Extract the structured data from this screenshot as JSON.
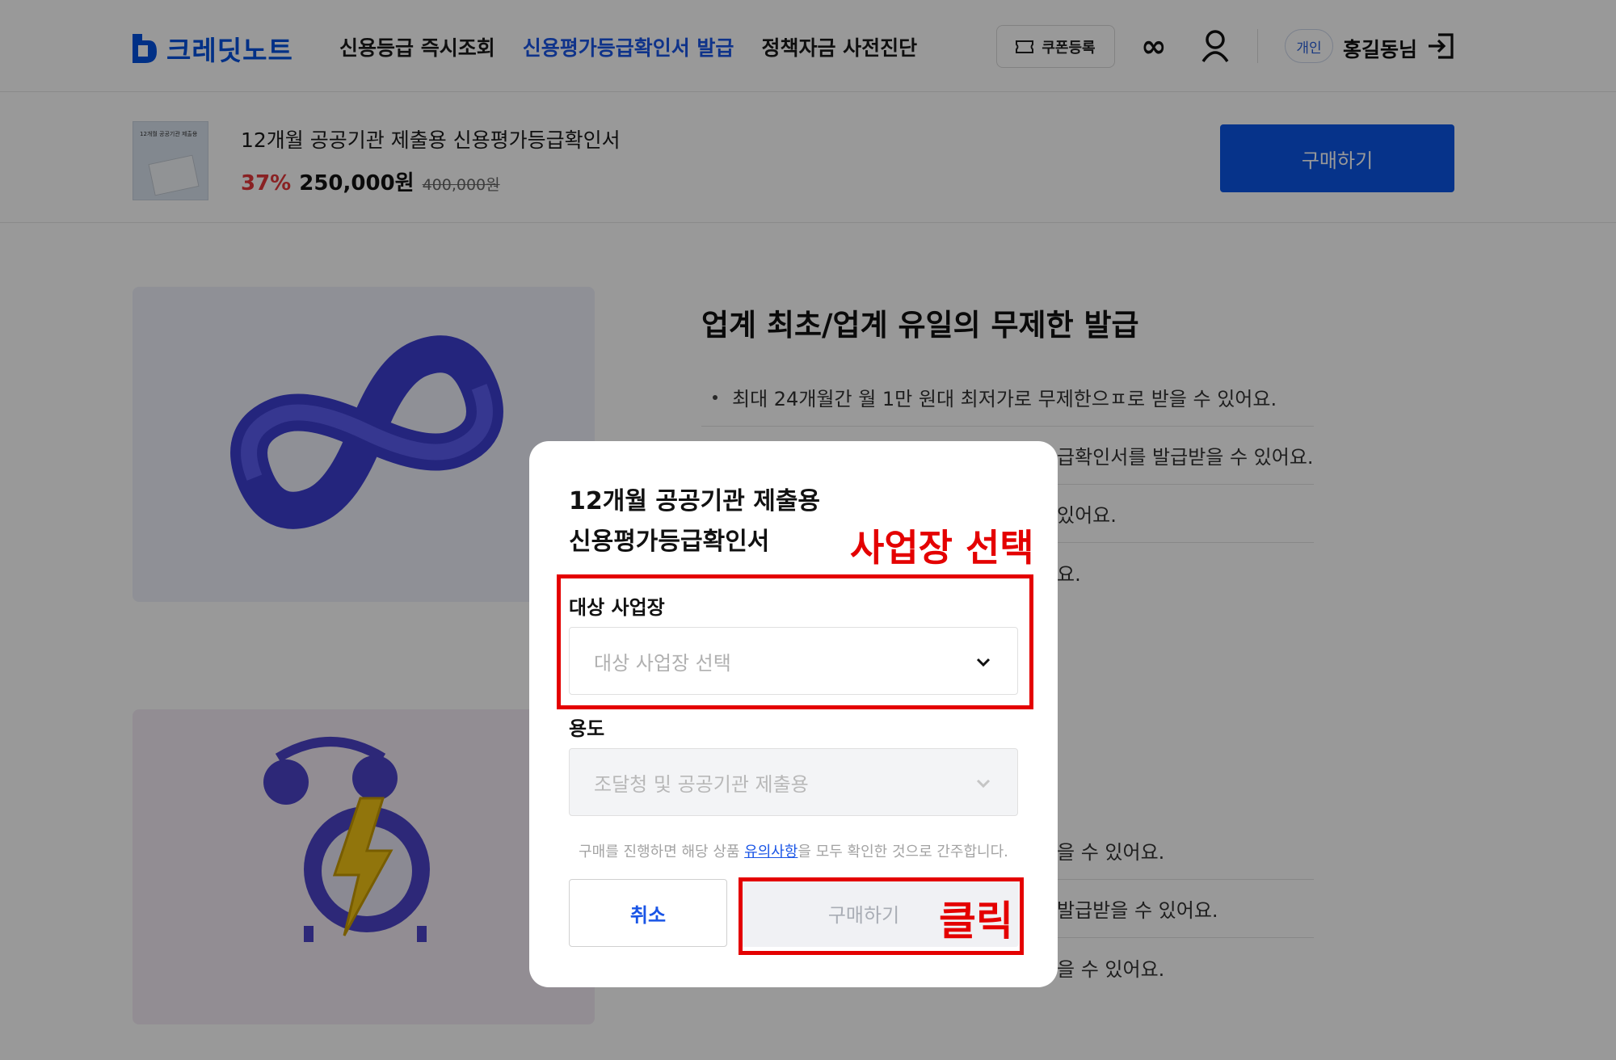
{
  "header": {
    "logo_text": "크레딧노트",
    "nav": [
      {
        "label": "신용등급 즉시조회",
        "active": false
      },
      {
        "label": "신용평가등급확인서 발급",
        "active": true
      },
      {
        "label": "정책자금 사전진단",
        "active": false
      }
    ],
    "coupon_label": "쿠폰등록",
    "badge": "개인",
    "user_name": "홍길동님",
    "icons": [
      "logo-icon",
      "coupon-icon",
      "infinity-icon",
      "user-icon",
      "logout-icon"
    ]
  },
  "product": {
    "thumb_text": "12개월 공공기관 제출용",
    "title": "12개월 공공기관 제출용 신용평가등급확인서",
    "discount": "37%",
    "price": "250,000원",
    "original_price": "400,000원",
    "buy_label": "구매하기"
  },
  "content": {
    "section_title": "업계 최초/업계 유일의 무제한 발급",
    "bullets": [
      "최대 24개월간 월 1만 원대 최저가로 무제한으ㅍ로 받을 수 있어요.",
      "급확인서를 발급받을 수 있어요.",
      "있어요.",
      "요."
    ],
    "bullets2": [
      "을 수 있어요.",
      "발급받을 수 있어요.",
      "을 수 있어요."
    ]
  },
  "modal": {
    "title_line1": "12개월 공공기관 제출용",
    "title_line2": "신용평가등급확인서",
    "target_label": "대상 사업장",
    "target_placeholder": "대상 사업장 선택",
    "purpose_label": "용도",
    "purpose_value": "조달청 및 공공기관 제출용",
    "notice_pre": "구매를 진행하면 해당 상품 ",
    "notice_link": "유의사항",
    "notice_post": "을 모두 확인한 것으로 간주합니다.",
    "cancel_label": "취소",
    "buy_label": "구매하기"
  },
  "annotations": {
    "select_note": "사업장 선택",
    "click_note": "클릭",
    "color": "#e40000"
  },
  "colors": {
    "brand": "#0a56e6",
    "discount": "#e5383b",
    "overlay": "rgba(0,0,0,0.4)"
  }
}
